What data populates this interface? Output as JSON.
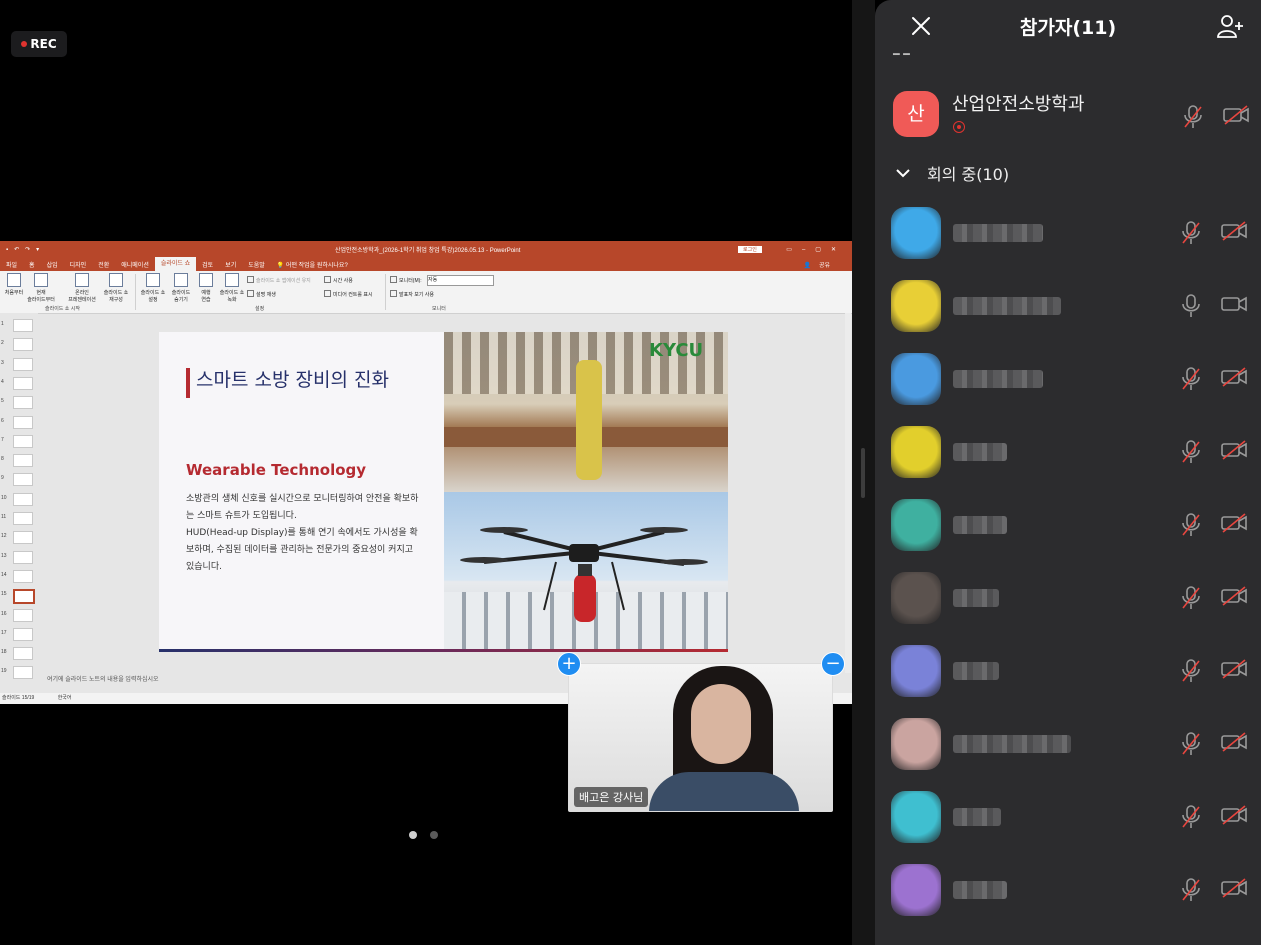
{
  "rec_label": "REC",
  "ppt": {
    "doc_title": "산업안전소방학과_(2026-1학기 취업 창업 특강)2026.05.13  -  PowerPoint",
    "login_label": "로그인",
    "tabs": [
      "파일",
      "홈",
      "삽입",
      "디자인",
      "전환",
      "애니메이션",
      "슬라이드 쇼",
      "검토",
      "보기",
      "도움말"
    ],
    "active_tab": "슬라이드 쇼",
    "tell_me": "어떤 작업을 원하시나요?",
    "share": "공유",
    "ribbon": {
      "from_start": "처음부터",
      "from_current": "현재\n슬라이드부터",
      "online": "온라인\n프레젠테이션",
      "custom": "슬라이드 쇼\n재구성",
      "group1": "슬라이드 쇼 시작",
      "setup": "슬라이드 쇼\n설정",
      "hide": "슬라이드\n숨기기",
      "rehearse": "예행\n연습",
      "record": "슬라이드 쇼\n녹화",
      "chk_narration": "슬라이드 쇼 앱에이션 유지",
      "chk_timing": "시간 사용",
      "chk_play": "설명 재생",
      "chk_media": "미디어 컨트롤 표시",
      "group2": "설정",
      "monitor_label": "모니터(M):",
      "monitor_value": "자동",
      "presenter": "발표자 보기 사용",
      "group3": "모니터"
    },
    "slide_numbers": [
      "1",
      "2",
      "3",
      "4",
      "5",
      "6",
      "7",
      "8",
      "9",
      "10",
      "11",
      "12",
      "13",
      "14",
      "15",
      "16",
      "17",
      "18",
      "19"
    ],
    "active_slide": 15,
    "slide": {
      "title": "스마트 소방 장비의 진화",
      "subtitle": "Wearable Technology",
      "body": "소방관의 생체 신호를 실시간으로 모니터링하여 안전을 확보하는 스마트 슈트가 도입됩니다.\nHUD(Head-up Display)를 통해 연기 속에서도 가시성을 확보하며, 수집된 데이터를 관리하는 전문가의 중요성이 커지고 있습니다.",
      "logo": "KYCU"
    },
    "notes": "여기에 슬라이드 노트의 내용을 입력하십시오",
    "status_slide": "슬라이드 15/19",
    "status_lang": "한국어"
  },
  "video": {
    "name": "배고은 강사님"
  },
  "pager": {
    "count": 2,
    "active": 1
  },
  "panel": {
    "title": "참가자(11)",
    "host": {
      "initial": "산",
      "name": "산업안전소방학과",
      "color": "#f05a57"
    },
    "section_label": "회의 중(10)",
    "participants": [
      {
        "color": "#3fa9e8",
        "muted": true,
        "cam_off": true
      },
      {
        "color": "#e8cf36",
        "muted": false,
        "cam_off": false
      },
      {
        "color": "#4a9ae0",
        "muted": true,
        "cam_off": true
      },
      {
        "color": "#e2cf2c",
        "muted": true,
        "cam_off": true
      },
      {
        "color": "#3fb0a0",
        "muted": true,
        "cam_off": true
      },
      {
        "color": "#5b524e",
        "muted": true,
        "cam_off": true
      },
      {
        "color": "#7a82d8",
        "muted": true,
        "cam_off": true
      },
      {
        "color": "#caa4a0",
        "muted": true,
        "cam_off": true
      },
      {
        "color": "#3fbfd0",
        "muted": true,
        "cam_off": true
      },
      {
        "color": "#9c72d0",
        "muted": true,
        "cam_off": true
      }
    ]
  }
}
